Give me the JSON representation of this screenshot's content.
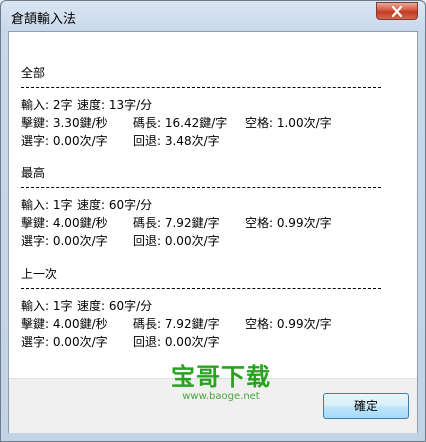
{
  "window": {
    "title": "倉頡輸入法"
  },
  "sections": [
    {
      "title": "全部",
      "row1": {
        "input": "輸入: 2字",
        "speed": "速度: 13字/分"
      },
      "row2": {
        "keystroke": "擊鍵: 3.30鍵/秒",
        "code_length": "碼長: 16.42鍵/字",
        "space": "空格: 1.00次/字"
      },
      "row3": {
        "select": "選字: 0.00次/字",
        "backspace": "回退: 3.48次/字"
      }
    },
    {
      "title": "最高",
      "row1": {
        "input": "輸入: 1字",
        "speed": "速度: 60字/分"
      },
      "row2": {
        "keystroke": "擊鍵: 4.00鍵/秒",
        "code_length": "碼長: 7.92鍵/字",
        "space": "空格: 0.99次/字"
      },
      "row3": {
        "select": "選字: 0.00次/字",
        "backspace": "回退: 0.00次/字"
      }
    },
    {
      "title": "上一次",
      "row1": {
        "input": "輸入: 1字",
        "speed": "速度: 60字/分"
      },
      "row2": {
        "keystroke": "擊鍵: 4.00鍵/秒",
        "code_length": "碼長: 7.92鍵/字",
        "space": "空格: 0.99次/字"
      },
      "row3": {
        "select": "選字: 0.00次/字",
        "backspace": "回退: 0.00次/字"
      }
    }
  ],
  "footer": {
    "ok_label": "確定"
  },
  "watermark": {
    "text": "宝哥下载",
    "url": "www.baoge.net"
  },
  "colors": {
    "close_button": "#c74a33",
    "watermark": "#27a31f",
    "ok_button_border": "#3c7fb1"
  }
}
